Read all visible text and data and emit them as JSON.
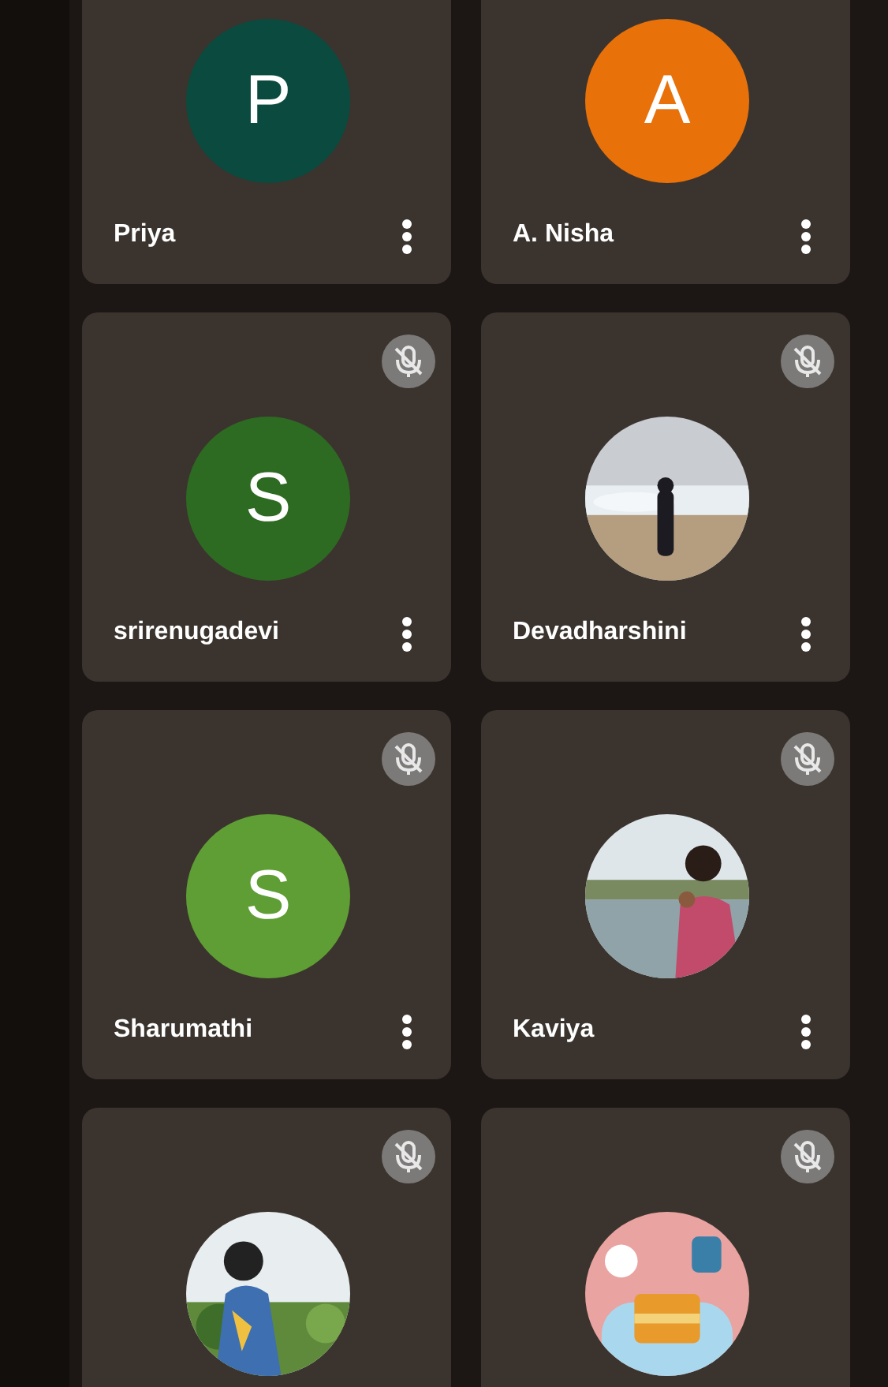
{
  "tiles": [
    {
      "name": "Priya",
      "avatar": {
        "kind": "letter",
        "letter": "P",
        "color": "#0b4a3e"
      }
    },
    {
      "name": "A. Nisha",
      "avatar": {
        "kind": "letter",
        "letter": "A",
        "color": "#e8710a"
      }
    },
    {
      "name": "srirenugadevi",
      "muted": true,
      "avatar": {
        "kind": "letter",
        "letter": "S",
        "color": "#2e6b22"
      }
    },
    {
      "name": "Devadharshini",
      "muted": true
    },
    {
      "name": "Sharumathi",
      "muted": true,
      "avatar": {
        "kind": "letter",
        "letter": "S",
        "color": "#5f9e35"
      }
    },
    {
      "name": "Kaviya",
      "muted": true
    },
    {
      "muted": true
    },
    {
      "muted": true
    }
  ]
}
